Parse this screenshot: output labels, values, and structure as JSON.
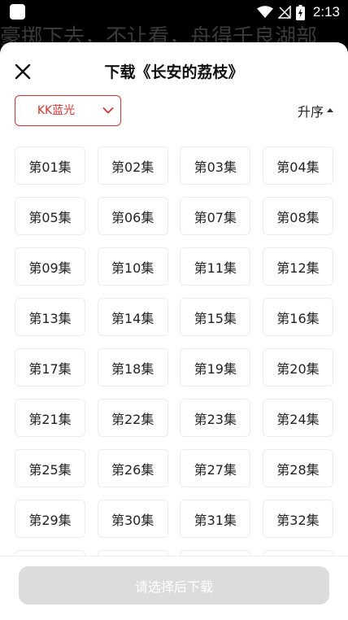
{
  "status_bar": {
    "time": "2:13",
    "icons": [
      "app-notification-icon",
      "wifi-icon",
      "signal-icon",
      "battery-charging-icon"
    ]
  },
  "background": {
    "text": "豪掷下去，不让看，舟得千良湖部"
  },
  "sheet": {
    "title": "下载《长安的荔枝》",
    "close_icon": "close-icon",
    "source": {
      "selected": "KK蓝光",
      "chevron_icon": "chevron-down-icon"
    },
    "sort": {
      "label": "升序",
      "arrow_icon": "sort-up-icon"
    },
    "episodes": [
      "第01集",
      "第02集",
      "第03集",
      "第04集",
      "第05集",
      "第06集",
      "第07集",
      "第08集",
      "第09集",
      "第10集",
      "第11集",
      "第12集",
      "第13集",
      "第14集",
      "第15集",
      "第16集",
      "第17集",
      "第18集",
      "第19集",
      "第20集",
      "第21集",
      "第22集",
      "第23集",
      "第24集",
      "第25集",
      "第26集",
      "第27集",
      "第28集",
      "第29集",
      "第30集",
      "第31集",
      "第32集",
      "",
      "",
      "",
      ""
    ],
    "download_button": "请选择后下载"
  },
  "colors": {
    "accent": "#e2302c",
    "disabled_button": "#dcdcdc",
    "episode_border": "#ececec"
  }
}
